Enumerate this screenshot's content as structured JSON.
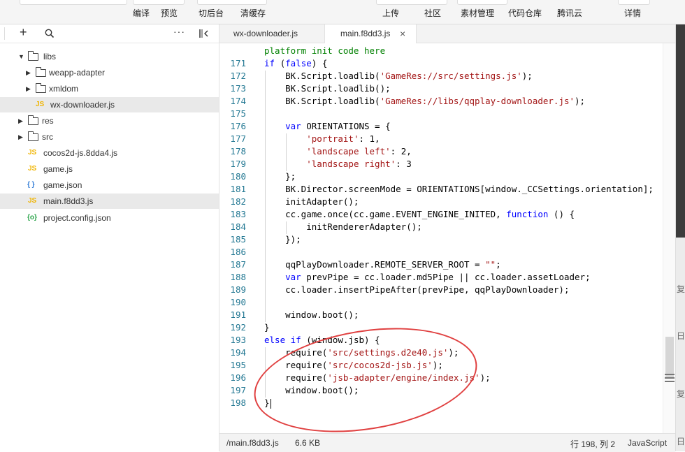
{
  "toolbar": {
    "items": [
      "编译",
      "预览",
      "切后台",
      "清缓存",
      "上传",
      "社区",
      "素材管理",
      "代码仓库",
      "腾讯云",
      "详情"
    ]
  },
  "explorer": {
    "tree": [
      {
        "label": "libs",
        "type": "folder",
        "expanded": true
      },
      {
        "label": "weapp-adapter",
        "type": "folder"
      },
      {
        "label": "xmldom",
        "type": "folder"
      },
      {
        "label": "wx-downloader.js",
        "type": "js",
        "icon_text": "JS"
      },
      {
        "label": "res",
        "type": "folder"
      },
      {
        "label": "src",
        "type": "folder"
      },
      {
        "label": "cocos2d-js.8dda4.js",
        "type": "js",
        "icon_text": "JS"
      },
      {
        "label": "game.js",
        "type": "js",
        "icon_text": "JS"
      },
      {
        "label": "game.json",
        "type": "json",
        "icon_text": "{ }"
      },
      {
        "label": "main.f8dd3.js",
        "type": "js",
        "icon_text": "JS",
        "selected": true
      },
      {
        "label": "project.config.json",
        "type": "config",
        "icon_text": "{o}"
      }
    ]
  },
  "editor": {
    "tabs": [
      {
        "label": "wx-downloader.js",
        "active": false
      },
      {
        "label": "main.f8dd3.js",
        "active": true,
        "close": "×"
      }
    ],
    "lines": [
      {
        "n": "",
        "text": "platform init code here"
      },
      {
        "n": "171",
        "text": "if (false) {"
      },
      {
        "n": "172",
        "text": "    BK.Script.loadlib('GameRes://src/settings.js');"
      },
      {
        "n": "173",
        "text": "    BK.Script.loadlib();"
      },
      {
        "n": "174",
        "text": "    BK.Script.loadlib('GameRes://libs/qqplay-downloader.js');"
      },
      {
        "n": "175",
        "text": ""
      },
      {
        "n": "176",
        "text": "    var ORIENTATIONS = {"
      },
      {
        "n": "177",
        "text": "        'portrait': 1,"
      },
      {
        "n": "178",
        "text": "        'landscape left': 2,"
      },
      {
        "n": "179",
        "text": "        'landscape right': 3"
      },
      {
        "n": "180",
        "text": "    };"
      },
      {
        "n": "181",
        "text": "    BK.Director.screenMode = ORIENTATIONS[window._CCSettings.orientation];"
      },
      {
        "n": "182",
        "text": "    initAdapter();"
      },
      {
        "n": "183",
        "text": "    cc.game.once(cc.game.EVENT_ENGINE_INITED, function () {"
      },
      {
        "n": "184",
        "text": "        initRendererAdapter();"
      },
      {
        "n": "185",
        "text": "    });"
      },
      {
        "n": "186",
        "text": ""
      },
      {
        "n": "187",
        "text": "    qqPlayDownloader.REMOTE_SERVER_ROOT = \"\";"
      },
      {
        "n": "188",
        "text": "    var prevPipe = cc.loader.md5Pipe || cc.loader.assetLoader;"
      },
      {
        "n": "189",
        "text": "    cc.loader.insertPipeAfter(prevPipe, qqPlayDownloader);"
      },
      {
        "n": "190",
        "text": ""
      },
      {
        "n": "191",
        "text": "    window.boot();"
      },
      {
        "n": "192",
        "text": "}"
      },
      {
        "n": "193",
        "text": "else if (window.jsb) {"
      },
      {
        "n": "194",
        "text": "    require('src/settings.d2e40.js');"
      },
      {
        "n": "195",
        "text": "    require('src/cocos2d-jsb.js');"
      },
      {
        "n": "196",
        "text": "    require('jsb-adapter/engine/index.js');"
      },
      {
        "n": "197",
        "text": "    window.boot();"
      },
      {
        "n": "198",
        "text": "}"
      }
    ]
  },
  "statusbar": {
    "path": "/main.f8dd3.js",
    "size": "6.6 KB",
    "position": "行 198, 列 2",
    "language": "JavaScript"
  },
  "right_strip": {
    "texts": [
      "复",
      "日",
      "复",
      "日"
    ]
  },
  "colors": {
    "keyword": "#0000ff",
    "string": "#a31515",
    "comment": "#008000",
    "line_number": "#237893",
    "annotation": "#e04040"
  }
}
